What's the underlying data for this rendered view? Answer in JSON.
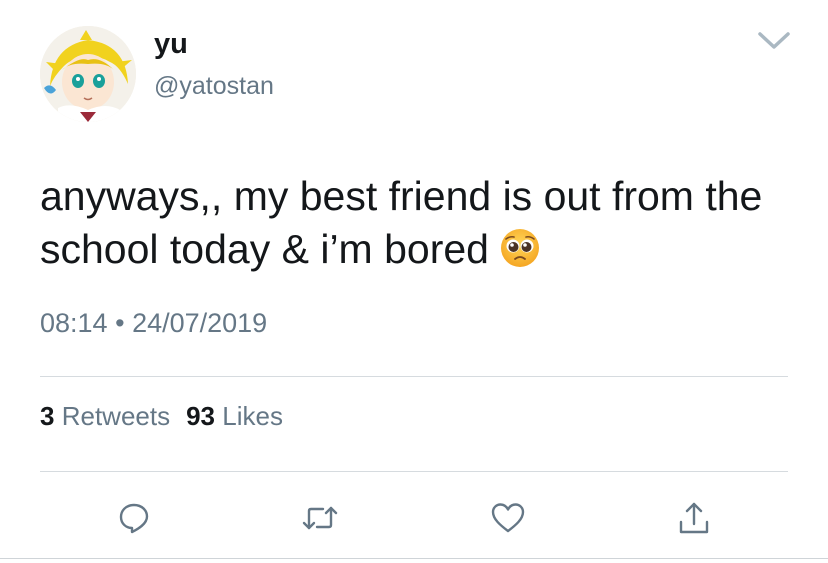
{
  "user": {
    "display_name": "yu",
    "handle": "@yatostan"
  },
  "tweet": {
    "text": "anyways,, my best friend is out from the school today & i’m bored",
    "emoji": "pleading-face",
    "time": "08:14",
    "separator": "•",
    "date": "24/07/2019"
  },
  "stats": {
    "retweets_count": "3",
    "retweets_label": "Retweets",
    "likes_count": "93",
    "likes_label": "Likes"
  },
  "actions": [
    "reply-icon",
    "retweet-icon",
    "like-icon",
    "share-icon"
  ],
  "colors": {
    "text_primary": "#14171a",
    "text_secondary": "#657786",
    "divider": "#d6dbdf",
    "icon": "#657786"
  }
}
